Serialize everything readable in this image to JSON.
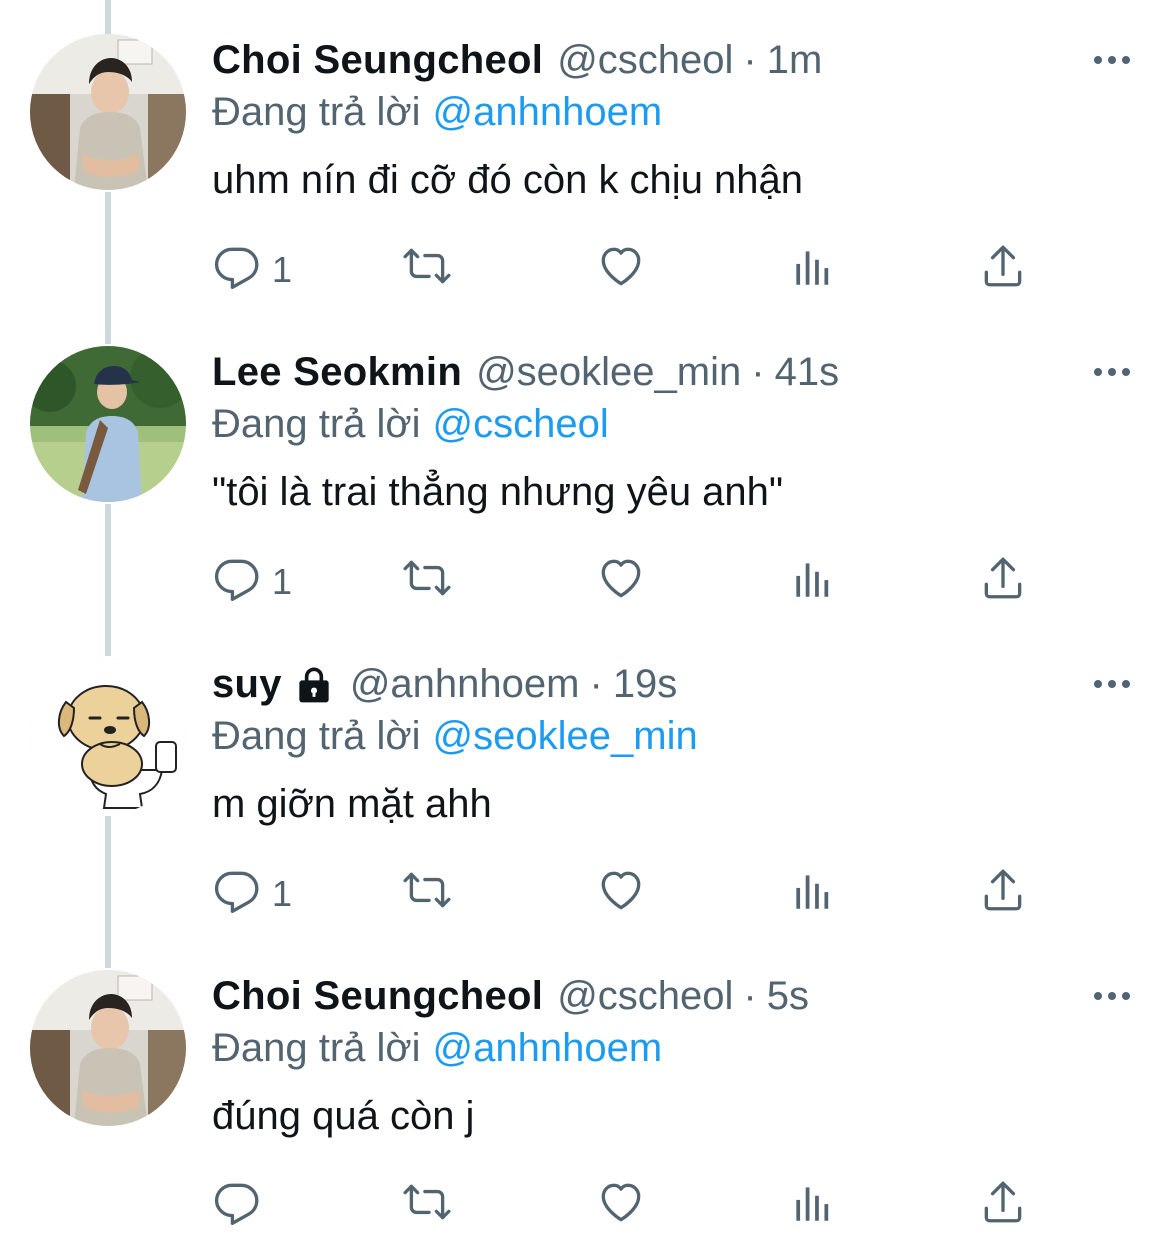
{
  "tweets": [
    {
      "display_name": "Choi Seungcheol",
      "locked": false,
      "handle": "@cscheol",
      "separator": "·",
      "time": "1m",
      "replying_prefix": "Đang trả lời",
      "replying_to": "@anhnhoem",
      "text": "uhm nín đi cỡ đó còn k chịu nhận",
      "reply_count": "1",
      "avatar_icon": "person-photo-icon"
    },
    {
      "display_name": "Lee Seokmin",
      "locked": false,
      "handle": "@seoklee_min",
      "separator": "·",
      "time": "41s",
      "replying_prefix": "Đang trả lời",
      "replying_to": "@cscheol",
      "text": "\"tôi là trai thẳng nhưng yêu anh\"",
      "reply_count": "1",
      "avatar_icon": "person-outdoor-photo-icon"
    },
    {
      "display_name": "suy",
      "locked": true,
      "handle": "@anhnhoem",
      "separator": "·",
      "time": "19s",
      "replying_prefix": "Đang trả lời",
      "replying_to": "@seoklee_min",
      "text": "m giỡn mặt ahh",
      "reply_count": "1",
      "avatar_icon": "cartoon-dog-icon"
    },
    {
      "display_name": "Choi Seungcheol",
      "locked": false,
      "handle": "@cscheol",
      "separator": "·",
      "time": "5s",
      "replying_prefix": "Đang trả lời",
      "replying_to": "@anhnhoem",
      "text": "đúng quá còn j",
      "reply_count": "",
      "avatar_icon": "person-photo-icon"
    }
  ],
  "colors": {
    "text": "#0f1419",
    "secondary": "#536471",
    "link": "#1d9bf0",
    "thread_line": "#cfd9de"
  },
  "icons": {
    "reply": "reply-icon",
    "retweet": "retweet-icon",
    "like": "heart-icon",
    "views": "views-icon",
    "share": "share-icon",
    "more": "more-icon",
    "lock": "lock-icon"
  }
}
